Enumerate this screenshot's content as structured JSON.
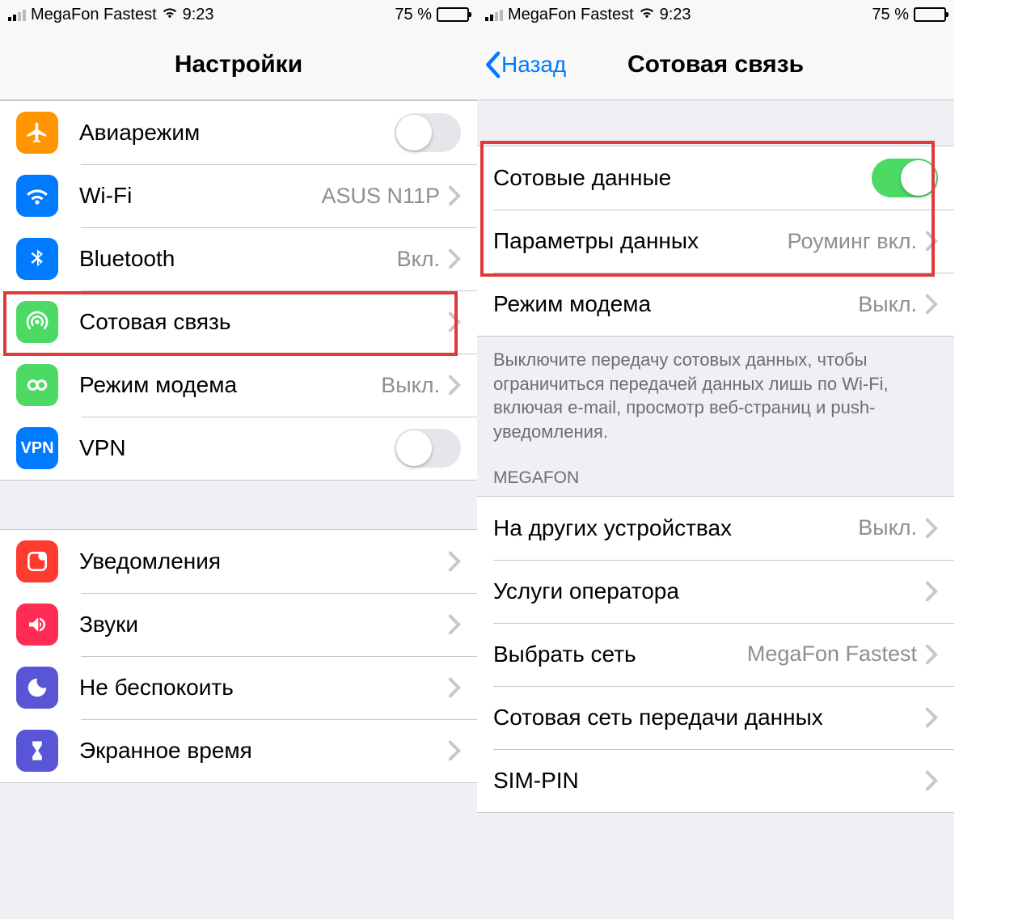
{
  "status": {
    "carrier": "MegaFon Fastest",
    "time": "9:23",
    "battery_pct": "75 %"
  },
  "left": {
    "title": "Настройки",
    "rows": {
      "airplane": "Авиарежим",
      "wifi": "Wi-Fi",
      "wifi_value": "ASUS N11P",
      "bluetooth": "Bluetooth",
      "bluetooth_value": "Вкл.",
      "cellular": "Сотовая связь",
      "hotspot": "Режим модема",
      "hotspot_value": "Выкл.",
      "vpn": "VPN",
      "notifications": "Уведомления",
      "sounds": "Звуки",
      "dnd": "Не беспокоить",
      "screentime": "Экранное время"
    }
  },
  "right": {
    "back": "Назад",
    "title": "Сотовая связь",
    "cellular_data": "Сотовые данные",
    "data_options": "Параметры данных",
    "data_options_value": "Роуминг вкл.",
    "hotspot": "Режим модема",
    "hotspot_value": "Выкл.",
    "footer": "Выключите передачу сотовых данных, чтобы ограничиться передачей данных лишь по Wi-Fi, включая e-mail, просмотр веб-страниц и push-уведомления.",
    "carrier_header": "MEGAFON",
    "other_devices": "На других устройствах",
    "other_devices_value": "Выкл.",
    "carrier_services": "Услуги оператора",
    "select_network": "Выбрать сеть",
    "select_network_value": "MegaFon Fastest",
    "apn": "Сотовая сеть передачи данных",
    "simpin": "SIM-PIN"
  }
}
